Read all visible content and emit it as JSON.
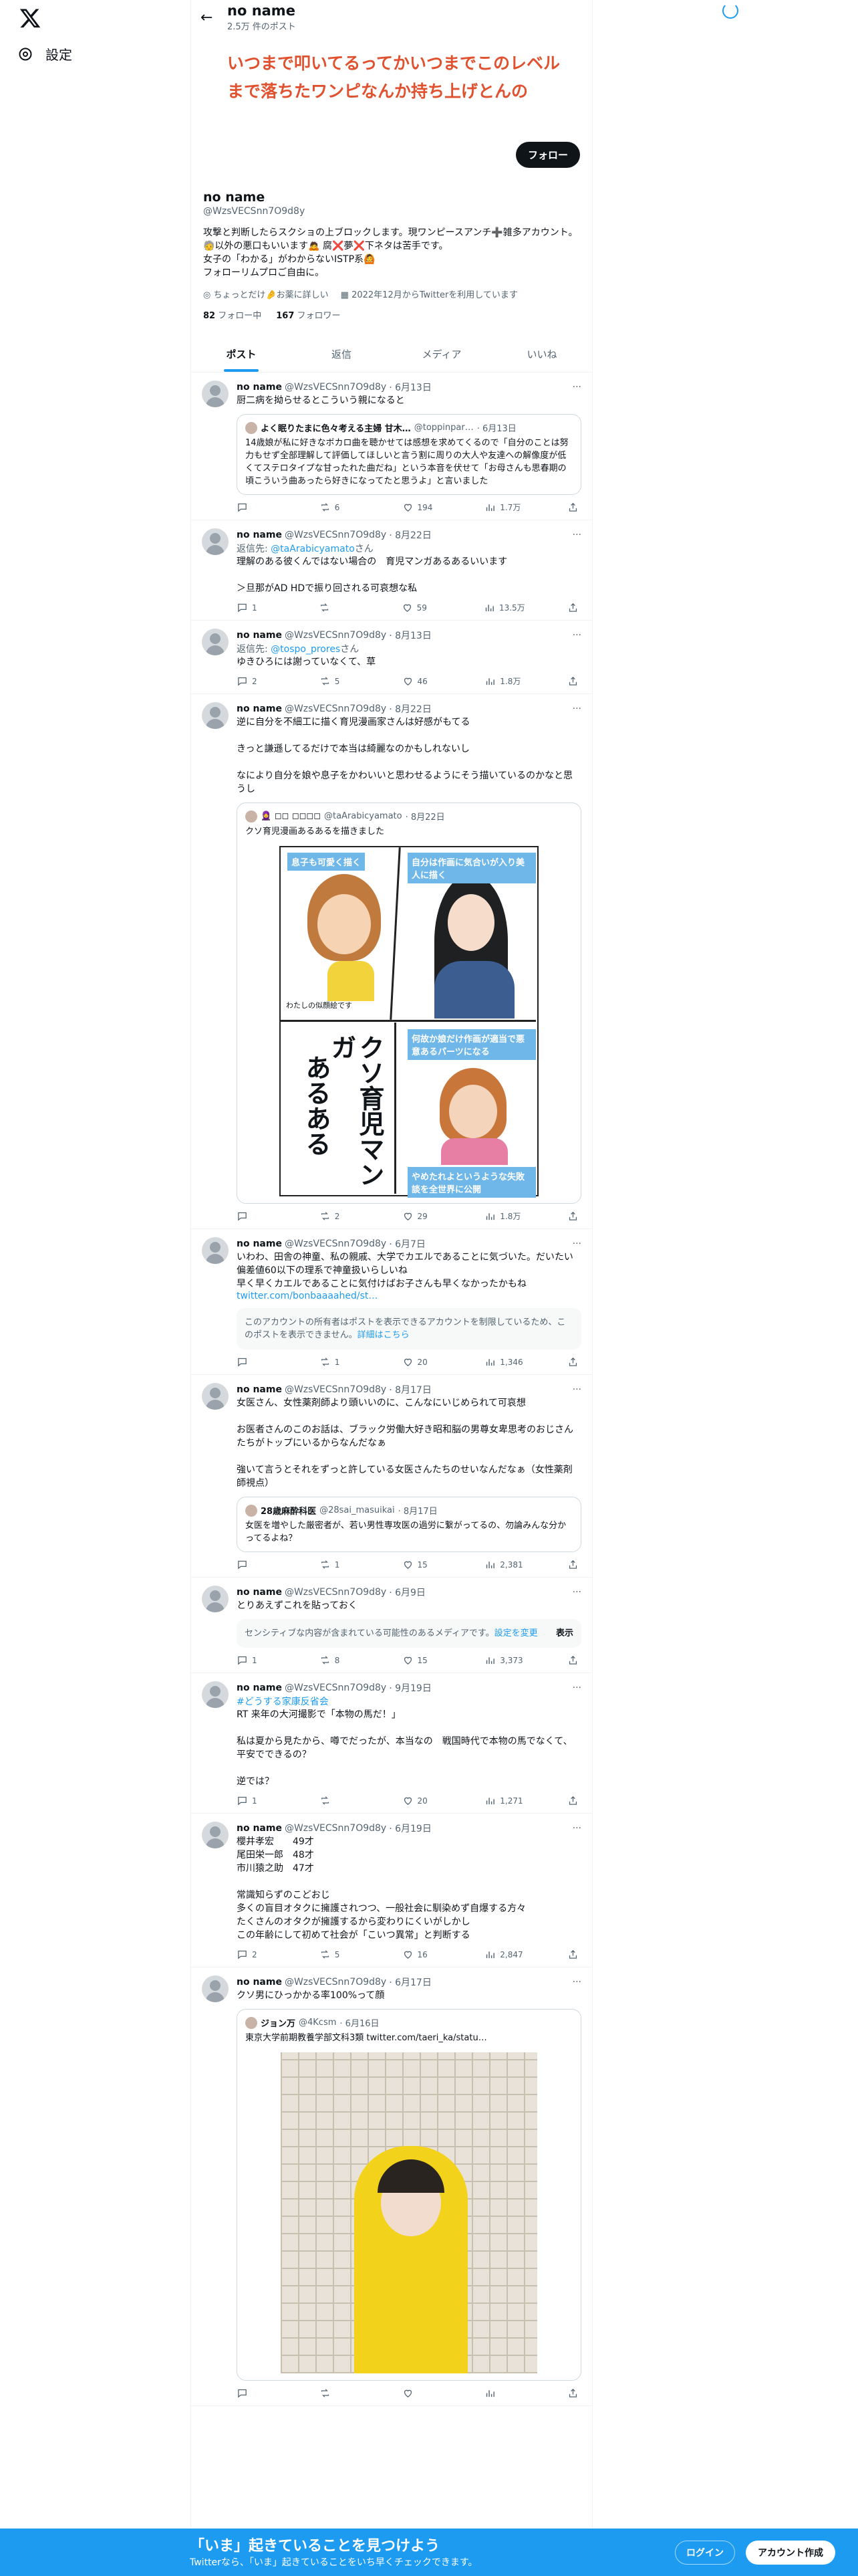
{
  "sidebar": {
    "settings_label": "設定"
  },
  "header": {
    "name": "no name",
    "post_count": "2.5万 件のポスト"
  },
  "banner": {
    "text": "いつまで叩いてるってかいつまでこのレベルまで落ちたワンピなんか持ち上げとんの"
  },
  "profile": {
    "follow_label": "フォロー",
    "display_name": "no name",
    "handle": "@WzsVECSnn7O9d8y",
    "bio": "攻撃と判断したらスクショの上ブロックします。現ワンピースアンチ➕雑多アカウント。🧓以外の悪口もいいます🙇 腐❌夢❌下ネタは苦手です。\n女子の「わかる」がわからないISTP系🙆\nフォローリムプロご自由に。",
    "location": "ちょっとだけ🤌お薬に詳しい",
    "joined": "2022年12月からTwitterを利用しています",
    "following_count": "82",
    "following_label": "フォロー中",
    "followers_count": "167",
    "followers_label": "フォロワー"
  },
  "tabs": [
    {
      "label": "ポスト"
    },
    {
      "label": "返信"
    },
    {
      "label": "メディア"
    },
    {
      "label": "いいね"
    }
  ],
  "tweets": [
    {
      "name": "no name",
      "handle": "@WzsVECSnn7O9d8y",
      "date": "· 6月13日",
      "text": "厨二病を拗らせるとこういう親になると",
      "quote": {
        "name": "よく眠りたまに色々考える主婦 甘木…",
        "handle": "@toppinpar…",
        "date": "· 6月13日",
        "text": "14歳娘が私に好きなボカロ曲を聴かせては感想を求めてくるので「自分のことは努力もせず全部理解して評価してほしいと言う割に周りの大人や友達への解像度が低くてステロタイプな甘ったれた曲だね」という本音を伏せて「お母さんも思春期の頃こういう曲あったら好きになってたと思うよ」と言いました"
      },
      "actions": {
        "reply": "",
        "retweet": "6",
        "like": "194",
        "views": "1.7万"
      }
    },
    {
      "name": "no name",
      "handle": "@WzsVECSnn7O9d8y",
      "date": "· 8月22日",
      "replying_prefix": "返信先: ",
      "replying_to": "@taArabicyamato",
      "replying_suffix": "さん",
      "text": "理解のある彼くんではない場合の　育児マンガあるあるいいます\n\n＞旦那がAD HDで振り回される可哀想な私",
      "actions": {
        "reply": "1",
        "retweet": "",
        "like": "59",
        "views": "13.5万"
      }
    },
    {
      "name": "no name",
      "handle": "@WzsVECSnn7O9d8y",
      "date": "· 8月13日",
      "replying_prefix": "返信先: ",
      "replying_to": "@tospo_prores",
      "replying_suffix": "さん",
      "text": "ゆきひろには謝っていなくて、草",
      "actions": {
        "reply": "2",
        "retweet": "5",
        "like": "46",
        "views": "1.8万"
      }
    },
    {
      "name": "no name",
      "handle": "@WzsVECSnn7O9d8y",
      "date": "· 8月22日",
      "text": "逆に自分を不細工に描く育児漫画家さんは好感がもてる\n\nきっと謙遜してるだけで本当は綺麗なのかもしれないし\n\nなにより自分を娘や息子をかわいいと思わせるようにそう描いているのかなと思うし",
      "quote": {
        "name": "🧕 ◻◻ ◻◻◻◻",
        "handle": "@taArabicyamato",
        "date": "· 8月22日",
        "text": "クソ育児漫画あるあるを描きました"
      },
      "comic": {
        "p1": "息子も可愛く描く",
        "p2": "自分は作画に気合いが入り美人に描く",
        "p3": "何故か娘だけ作画が適当で悪意あるパーツになる",
        "p4": "やめたれよというような失敗談を全世界に公開",
        "big1": "クソ育児マンガ",
        "big2": "あるある",
        "small": "わたしの似顔絵です"
      },
      "actions": {
        "reply": "",
        "retweet": "2",
        "like": "29",
        "views": "1.8万"
      }
    },
    {
      "name": "no name",
      "handle": "@WzsVECSnn7O9d8y",
      "date": "· 6月7日",
      "text": "いわわ、田舎の神童、私の親戚、大学でカエルであることに気づいた。だいたい偏差値60以下の理系で神童扱いらしいね\n早く早くカエルであることに気付けばお子さんも早くなかったかもね",
      "link": "twitter.com/bonbaaaahed/st…",
      "notice": "このアカウントの所有者はポストを表示できるアカウントを制限しているため、このポストを表示できません。",
      "notice_link": "詳細はこちら",
      "actions": {
        "reply": "",
        "retweet": "1",
        "like": "20",
        "views": "1,346"
      }
    },
    {
      "name": "no name",
      "handle": "@WzsVECSnn7O9d8y",
      "date": "· 8月17日",
      "text": "女医さん、女性薬剤師より頭いいのに、こんなにいじめられて可哀想\n\nお医者さんのこのお話は、ブラック労働大好き昭和脳の男尊女卑思考のおじさんたちがトップにいるからなんだなぁ\n\n強いて言うとそれをずっと許している女医さんたちのせいなんだなぁ（女性薬剤師視点）",
      "quote": {
        "name": "28歳麻酔科医",
        "handle": "@28sai_masuikai",
        "date": "· 8月17日",
        "text": "女医を増やした厳密者が、若い男性専攻医の過労に繋がってるの、勿論みんな分かってるよね？"
      },
      "actions": {
        "reply": "",
        "retweet": "1",
        "like": "15",
        "views": "2,381"
      }
    },
    {
      "name": "no name",
      "handle": "@WzsVECSnn7O9d8y",
      "date": "· 6月9日",
      "text": "とりあえずこれを貼っておく",
      "sensitive": "センシティブな内容が含まれている可能性のあるメディアです。",
      "sensitive_link": "設定を変更",
      "sensitive_show": "表示",
      "actions": {
        "reply": "1",
        "retweet": "8",
        "like": "15",
        "views": "3,373"
      }
    },
    {
      "name": "no name",
      "handle": "@WzsVECSnn7O9d8y",
      "date": "· 9月19日",
      "hashtag": "#どうする家康反省会",
      "text": "RT 来年の大河撮影で「本物の馬だ！」\n\n私は夏から見たから、噂でだったが、本当なの　戦国時代で本物の馬でなくて、平安でできるの？\n\n逆では？",
      "actions": {
        "reply": "1",
        "retweet": "",
        "like": "20",
        "views": "1,271"
      }
    },
    {
      "name": "no name",
      "handle": "@WzsVECSnn7O9d8y",
      "date": "· 6月19日",
      "text": "櫻井孝宏　　49才\n尾田栄一郎　48才\n市川猿之助　47才\n\n常識知らずのこどおじ\n多くの盲目オタクに擁護されつつ、一般社会に馴染めず自爆する方々\nたくさんのオタクが擁護するから変わりにくいがしかし\nこの年齢にして初めて社会が「こいつ異常」と判断する",
      "actions": {
        "reply": "2",
        "retweet": "5",
        "like": "16",
        "views": "2,847"
      }
    },
    {
      "name": "no name",
      "handle": "@WzsVECSnn7O9d8y",
      "date": "· 6月17日",
      "text": "クソ男にひっかかる率100%って顔",
      "quote": {
        "name": "ジョン万",
        "handle": "@4Kcsm",
        "date": "· 6月16日",
        "text": "東京大学前期教養学部文科3類 twitter.com/taeri_ka/statu…"
      },
      "actions": {
        "reply": "",
        "retweet": "",
        "like": "",
        "views": ""
      }
    }
  ],
  "bottom_bar": {
    "title": "「いま」起きていることを見つけよう",
    "subtitle": "Twitterなら、「いま」起きていることをいち早くチェックできます。",
    "login_label": "ログイン",
    "signup_label": "アカウント作成"
  }
}
